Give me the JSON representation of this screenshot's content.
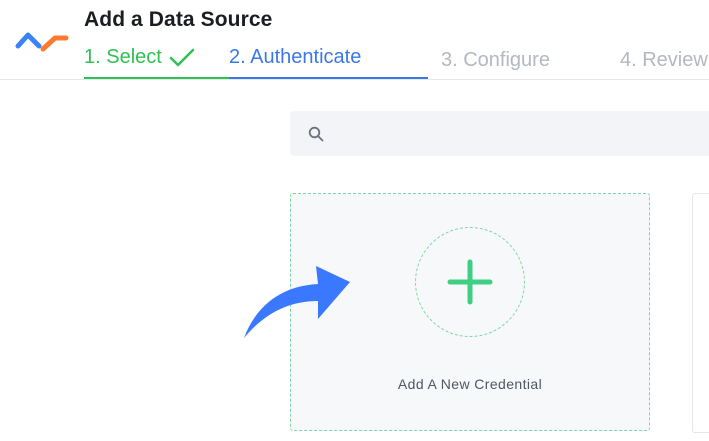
{
  "header": {
    "title": "Add a Data Source",
    "logo_icon": "stitch-logo-icon"
  },
  "steps": [
    {
      "label": "1. Select",
      "state": "complete",
      "icon": "check-icon"
    },
    {
      "label": "2. Authenticate",
      "state": "active"
    },
    {
      "label": "3. Configure",
      "state": "upcoming"
    },
    {
      "label": "4. Review",
      "state": "upcoming"
    }
  ],
  "search": {
    "value": "",
    "placeholder": "",
    "icon": "search-icon"
  },
  "add_credential": {
    "label": "Add A New Credential",
    "icon": "plus-icon"
  },
  "pointer": {
    "icon": "curved-arrow-icon"
  },
  "colors": {
    "complete": "#2fc153",
    "active": "#3b78e7",
    "upcoming": "#b3b8c0",
    "accent_green": "#3fcf84",
    "arrow_blue": "#3a78ff",
    "logo_blue": "#3b82f6",
    "logo_orange": "#ff7a2f"
  }
}
